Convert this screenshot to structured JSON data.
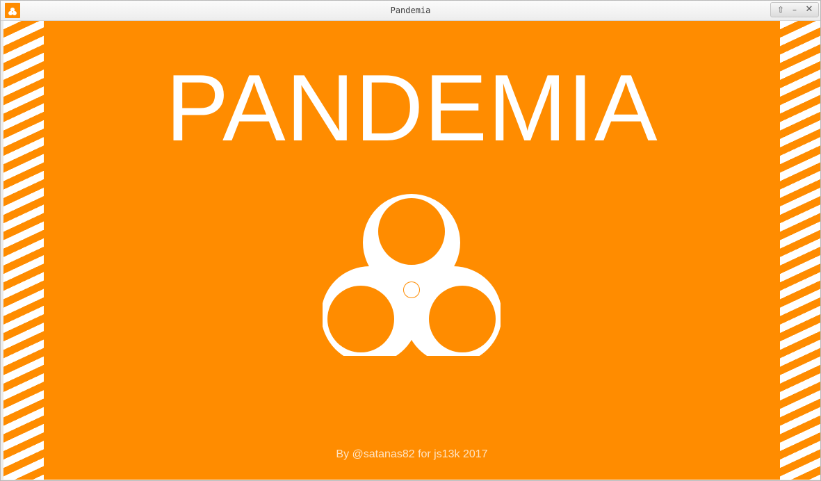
{
  "window": {
    "title": "Pandemia",
    "controls": {
      "up_icon": "⇧",
      "minimize_icon": "–",
      "close_icon": "✕"
    }
  },
  "game": {
    "title": "PANDEMIA",
    "credit": "By @satanas82 for js13k 2017",
    "emblem": "biohazard-icon",
    "colors": {
      "background": "#ff8c00",
      "foreground": "#ffffff"
    }
  }
}
